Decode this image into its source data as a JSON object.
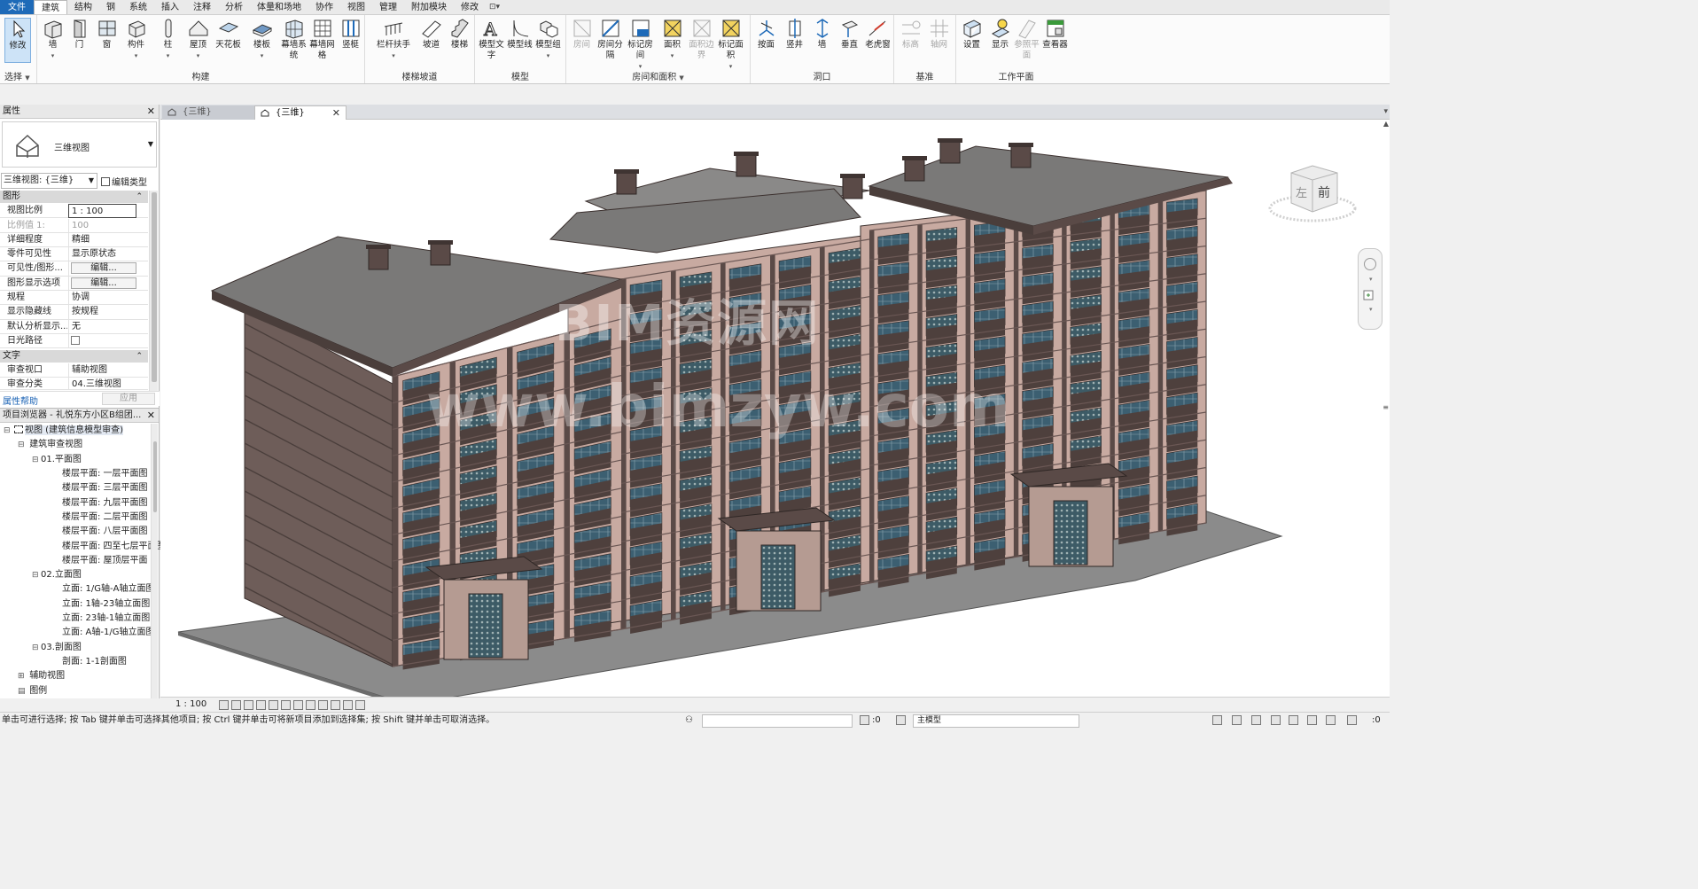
{
  "menu": {
    "file": "文件",
    "tabs": [
      "建筑",
      "结构",
      "钢",
      "系统",
      "插入",
      "注释",
      "分析",
      "体量和场地",
      "协作",
      "视图",
      "管理",
      "附加模块",
      "修改"
    ],
    "active_tab": "建筑",
    "qa_toggle": "⊡▾"
  },
  "ribbon": {
    "select": {
      "modify": "修改",
      "panel": "选择"
    },
    "build": {
      "panel": "构建",
      "buttons": [
        "墙",
        "门",
        "窗",
        "构件",
        "柱",
        "屋顶",
        "天花板",
        "楼板",
        "幕墙系统",
        "幕墙网格",
        "竖梃"
      ]
    },
    "stairs": {
      "panel": "楼梯坡道",
      "buttons": [
        "栏杆扶手",
        "坡道",
        "楼梯"
      ]
    },
    "model": {
      "panel": "模型",
      "buttons": [
        "模型文字",
        "模型线",
        "模型组"
      ]
    },
    "room": {
      "panel": "房间和面积",
      "buttons": [
        "房间",
        "房间分隔",
        "标记房间",
        "面积",
        "面积边界",
        "标记面积"
      ]
    },
    "opening": {
      "panel": "洞口",
      "buttons": [
        "按面",
        "竖井",
        "墙",
        "垂直",
        "老虎窗"
      ]
    },
    "datum": {
      "panel": "基准",
      "buttons": [
        "标高",
        "轴网"
      ]
    },
    "workplane": {
      "panel": "工作平面",
      "buttons": [
        "设置",
        "显示",
        "参照平面",
        "查看器"
      ]
    }
  },
  "properties": {
    "header": "属性",
    "type_name": "三维视图",
    "view_selector": "三维视图: {三维}",
    "edit_type": "编辑类型",
    "group_graphics": "图形",
    "rows": [
      {
        "k": "视图比例",
        "v": "1 : 100"
      },
      {
        "k": "比例值 1:",
        "v": "100"
      },
      {
        "k": "详细程度",
        "v": "精细"
      },
      {
        "k": "零件可见性",
        "v": "显示原状态"
      },
      {
        "k": "可见性/图形...",
        "v": "编辑..."
      },
      {
        "k": "图形显示选项",
        "v": "编辑..."
      },
      {
        "k": "规程",
        "v": "协调"
      },
      {
        "k": "显示隐藏线",
        "v": "按规程"
      },
      {
        "k": "默认分析显示...",
        "v": "无"
      },
      {
        "k": "日光路径",
        "v": ""
      }
    ],
    "group_text": "文字",
    "text_rows": [
      {
        "k": "审查视口",
        "v": "辅助视图"
      },
      {
        "k": "审查分类",
        "v": "04.三维视图"
      }
    ],
    "help": "属性帮助",
    "apply": "应用"
  },
  "browser": {
    "header": "项目浏览器 - 礼悦东方小区B组团...",
    "root": "视图 (建筑信息模型审查)",
    "review": "建筑审查视图",
    "plans": "01.平面图",
    "plan_items": [
      "楼层平面: 一层平面图",
      "楼层平面: 三层平面图",
      "楼层平面: 九层平面图",
      "楼层平面: 二层平面图",
      "楼层平面: 八层平面图",
      "楼层平面: 四至七层平面图",
      "楼层平面: 屋顶层平面"
    ],
    "elevations": "02.立面图",
    "elevation_items": [
      "立面: 1/G轴-A轴立面图",
      "立面: 1轴-23轴立面图",
      "立面: 23轴-1轴立面图",
      "立面: A轴-1/G轴立面图"
    ],
    "sections": "03.剖面图",
    "section_items": [
      "剖面: 1-1剖面图"
    ],
    "aux": "辅助视图",
    "legend": "图例"
  },
  "viewtabs": [
    {
      "label": "{三维}",
      "active": false
    },
    {
      "label": "{三维}",
      "active": true
    }
  ],
  "viewcube": {
    "left": "左",
    "front": "前"
  },
  "watermark": {
    "line1": "BIM资源网",
    "line2": "www.bimzyw.com"
  },
  "view_status": {
    "scale": "1 : 100"
  },
  "statusbar": {
    "message": "单击可进行选择; 按 Tab 键并单击可选择其他项目; 按 Ctrl 键并单击可将新项目添加到选择集; 按 Shift 键并单击可取消选择。",
    "filter_count": ":0",
    "model_combo": "主模型",
    "select_count": ":0"
  },
  "colors": {
    "accent": "#1e6ab8",
    "facade": "#c9aaa1",
    "pier": "#5a4a47",
    "roof": "#7a7978",
    "ground": "#8b8b8b",
    "glass": "#365a6e"
  }
}
